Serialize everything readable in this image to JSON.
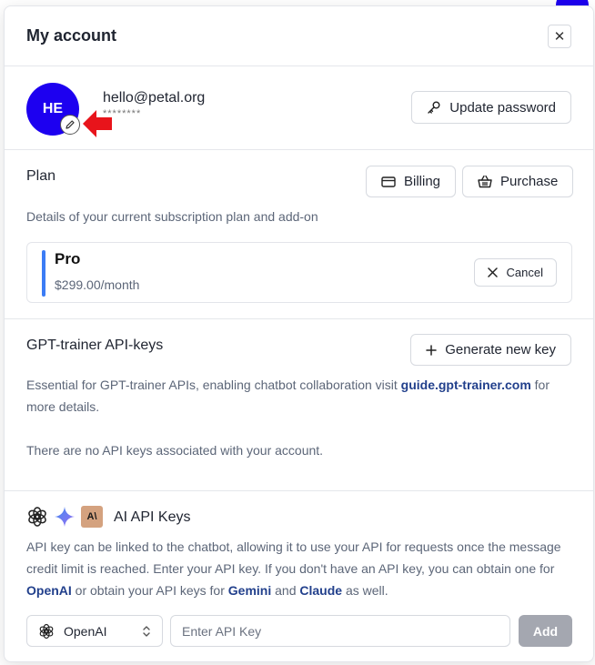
{
  "header": {
    "title": "My account",
    "close_label": "✕"
  },
  "profile": {
    "initials": "HE",
    "email": "hello@petal.org",
    "password_mask": "********",
    "update_password_label": "Update password"
  },
  "plan": {
    "title": "Plan",
    "billing_label": "Billing",
    "purchase_label": "Purchase",
    "description": "Details of your current subscription plan and add-on",
    "name": "Pro",
    "price": "$299.00/month",
    "cancel_label": "Cancel"
  },
  "api_keys": {
    "title": "GPT-trainer API-keys",
    "generate_label": "Generate new key",
    "desc_prefix": "Essential for GPT-trainer APIs, enabling chatbot collaboration visit ",
    "desc_link": "guide.gpt-trainer.com",
    "desc_suffix": " for more details.",
    "empty_text": "There are no API keys associated with your account."
  },
  "ai_keys": {
    "title": "AI API Keys",
    "anthropic_mark": "A\\",
    "desc_1": "API key can be linked to the chatbot, allowing it to use your API for requests once the message credit limit is reached. Enter your API key. If you don't have an API key, you can obtain one for ",
    "link_openai": "OpenAI",
    "desc_2": " or obtain your API keys for ",
    "link_gemini": "Gemini",
    "desc_3": " and ",
    "link_claude": "Claude",
    "desc_4": " as well.",
    "provider": "OpenAI",
    "input_placeholder": "Enter API Key",
    "add_label": "Add"
  },
  "colors": {
    "avatar": "#1d00f0",
    "plan_accent": "#3b7cf5",
    "link": "#22408c",
    "add_disabled": "#a4a7b0",
    "annotation_arrow": "#e8141b"
  },
  "icons": [
    "close-icon",
    "pencil-icon",
    "key-icon",
    "credit-card-icon",
    "basket-icon",
    "plus-icon",
    "openai-icon",
    "gemini-icon",
    "anthropic-icon",
    "chevron-updown-icon"
  ]
}
